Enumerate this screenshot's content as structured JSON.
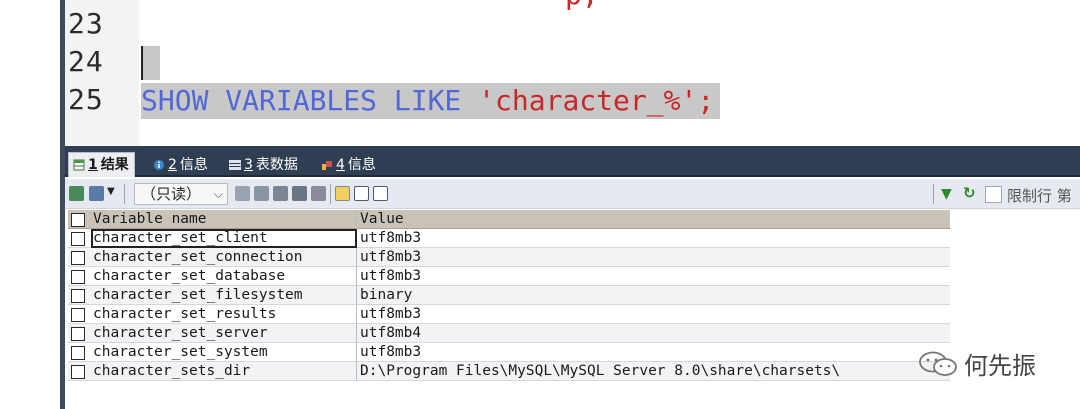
{
  "editor": {
    "top_fragment": "p;",
    "lines": [
      {
        "no": "23",
        "code": ""
      },
      {
        "no": "24",
        "code": ""
      },
      {
        "no": "25",
        "keywords": "SHOW VARIABLES LIKE ",
        "string": "'character_%'",
        "terminator": ";"
      }
    ]
  },
  "results": {
    "tabs": [
      {
        "num": "1",
        "label": "结果",
        "active": true,
        "icon": "table-result-icon"
      },
      {
        "num": "2",
        "label": "信息",
        "active": false,
        "icon": "info-icon"
      },
      {
        "num": "3",
        "label": "表数据",
        "active": false,
        "icon": "table-data-icon"
      },
      {
        "num": "4",
        "label": "信息",
        "active": false,
        "icon": "info-icon"
      }
    ],
    "toolbar": {
      "readonly_select": "（只读）",
      "limit_label": "限制行 第",
      "icons": [
        "export-icon",
        "import-icon",
        "copy-icon",
        "paste-icon",
        "save-icon",
        "delete-icon",
        "discard-icon",
        "grid-view-icon",
        "form-view-icon",
        "text-view-icon",
        "filter-icon",
        "refresh-icon"
      ]
    },
    "columns": [
      "Variable name",
      "Value"
    ],
    "rows": [
      [
        "character_set_client",
        "utf8mb3"
      ],
      [
        "character_set_connection",
        "utf8mb3"
      ],
      [
        "character_set_database",
        "utf8mb3"
      ],
      [
        "character_set_filesystem",
        "binary"
      ],
      [
        "character_set_results",
        "utf8mb3"
      ],
      [
        "character_set_server",
        "utf8mb4"
      ],
      [
        "character_set_system",
        "utf8mb3"
      ],
      [
        "character_sets_dir",
        "D:\\Program Files\\MySQL\\MySQL Server 8.0\\share\\charsets\\"
      ]
    ]
  },
  "watermark": {
    "text": "何先振"
  },
  "colors": {
    "keyword": "#5168d6",
    "string": "#c82828",
    "selection": "#c8c8c8",
    "tabbar": "#2f3e52",
    "header": "#c9c3b8"
  }
}
